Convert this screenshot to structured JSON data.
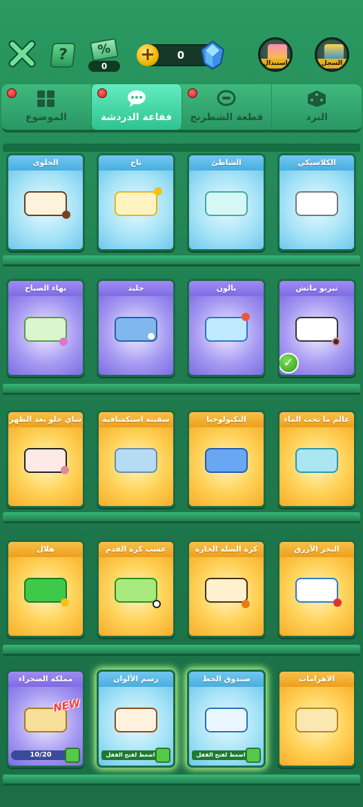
{
  "header": {
    "discount_percent": "%",
    "discount_count": "0",
    "gem_count": "0",
    "exchange_label": "استبدال",
    "log_label": "السجل"
  },
  "tabs": [
    {
      "label": "الموضوع",
      "icon": "grid-icon",
      "active": false,
      "dot": true
    },
    {
      "label": "فقاعة الدردشة",
      "icon": "chat-bubble-icon",
      "active": true,
      "dot": true
    },
    {
      "label": "قطعة الشطرنج",
      "icon": "chess-piece-icon",
      "active": false,
      "dot": true
    },
    {
      "label": "النرد",
      "icon": "dice-icon",
      "active": false,
      "dot": false
    }
  ],
  "rows": [
    {
      "theme": "blue",
      "items": [
        "الكلاسيكي",
        "الشاطئ",
        "تاج",
        "الحلوى"
      ]
    },
    {
      "theme": "purple",
      "items": [
        "تيربو ماتش",
        "بالون",
        "جليد",
        "بهاء الصباح"
      ]
    },
    {
      "theme": "orange",
      "items": [
        "عالم ما تحت الماء",
        "التكنولوجيا",
        "سفينة استكشافية",
        "شاي حلو بعد الظهر"
      ]
    },
    {
      "theme": "orange",
      "items": [
        "البحر الأزرق",
        "كرة السلة الحارة",
        "عشب كرة القدم",
        "هلال"
      ]
    },
    {
      "theme": "mixed",
      "items": [
        "الاهرامات",
        "صندوق الحظ",
        "رسم الألوان",
        "مملكة الصحراء"
      ]
    }
  ],
  "badges": {
    "new_label": "NEW",
    "progress": "10/20",
    "unlock_label": "اضغط لفتح القفل"
  },
  "colors": {
    "background": "#1f7d4f",
    "tab_active": "#2ec38f",
    "notification_dot": "#d91a1a"
  }
}
